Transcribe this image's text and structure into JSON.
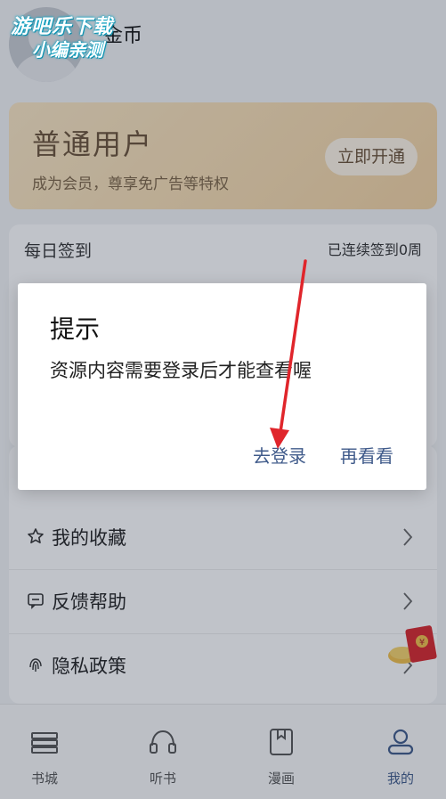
{
  "watermark": {
    "line1": "游吧乐下载",
    "line2": "小编亲测"
  },
  "profile": {
    "coins_label": "金币"
  },
  "vip": {
    "title": "普通用户",
    "subtitle": "成为会员，尊享免广告等特权",
    "button": "立即开通"
  },
  "checkin": {
    "title": "每日签到",
    "streak": "已连续签到0周"
  },
  "menu": {
    "items": [
      {
        "label": "我的收藏",
        "icon": "star-icon"
      },
      {
        "label": "反馈帮助",
        "icon": "feedback-icon"
      },
      {
        "label": "隐私政策",
        "icon": "fingerprint-icon"
      }
    ]
  },
  "tabbar": {
    "tabs": [
      {
        "label": "书城",
        "icon": "bookshelf-icon"
      },
      {
        "label": "听书",
        "icon": "headphones-icon"
      },
      {
        "label": "漫画",
        "icon": "comic-icon"
      },
      {
        "label": "我的",
        "icon": "user-icon",
        "active": true
      }
    ]
  },
  "dialog": {
    "title": "提示",
    "message": "资源内容需要登录后才能查看喔",
    "primary_button": "去登录",
    "secondary_button": "再看看"
  },
  "colors": {
    "accent": "#3f5a8a",
    "vip_gold": "#f7dcb0",
    "annotation_arrow": "#e0252b"
  }
}
